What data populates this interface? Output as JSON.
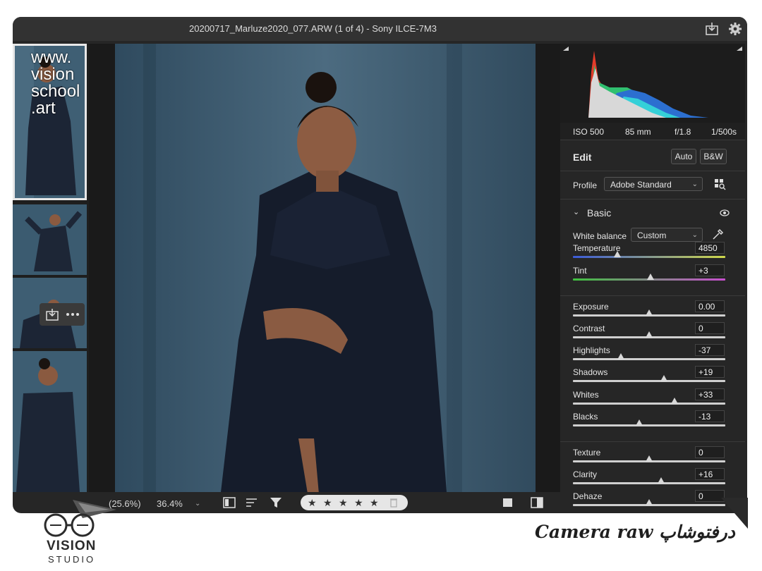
{
  "window": {
    "title": "20200717_Marluze2020_077.ARW (1 of 4)  -  Sony ILCE-7M3",
    "icons": [
      "save-icon",
      "gear-icon"
    ]
  },
  "watermark": {
    "lines": [
      "www.",
      "vision",
      "school",
      ".art"
    ]
  },
  "filmstrip": {
    "thumbnail_count": 4,
    "selected_index": 0,
    "overlay_icons": [
      "import-icon",
      "more-icon"
    ]
  },
  "bottom_bar": {
    "fit_zoom": "(25.6%)",
    "zoom": "36.4%",
    "stars": [
      "★",
      "★",
      "★",
      "★",
      "★"
    ],
    "icons": [
      "filmstrip-toggle-icon",
      "sort-icon",
      "filter-icon",
      "trash-icon",
      "view-mode-icon",
      "before-after-icon"
    ]
  },
  "exif": {
    "iso": "ISO 500",
    "focal": "85 mm",
    "aperture": "f/1.8",
    "shutter": "1/500s"
  },
  "edit": {
    "title": "Edit",
    "auto_label": "Auto",
    "bw_label": "B&W",
    "profile_label": "Profile",
    "profile_value": "Adobe Standard",
    "basic_label": "Basic",
    "wb_label": "White balance",
    "wb_value": "Custom"
  },
  "sliders": [
    {
      "label": "Temperature",
      "value": "4850",
      "pos": 0.29,
      "track": "temperature"
    },
    {
      "label": "Tint",
      "value": "+3",
      "pos": 0.51,
      "track": "tint"
    },
    {
      "label": "Exposure",
      "value": "0.00",
      "pos": 0.5,
      "track": "plain"
    },
    {
      "label": "Contrast",
      "value": "0",
      "pos": 0.5,
      "track": "plain"
    },
    {
      "label": "Highlights",
      "value": "-37",
      "pos": 0.315,
      "track": "plain"
    },
    {
      "label": "Shadows",
      "value": "+19",
      "pos": 0.595,
      "track": "plain"
    },
    {
      "label": "Whites",
      "value": "+33",
      "pos": 0.665,
      "track": "plain"
    },
    {
      "label": "Blacks",
      "value": "-13",
      "pos": 0.435,
      "track": "plain"
    },
    {
      "label": "Texture",
      "value": "0",
      "pos": 0.5,
      "track": "plain"
    },
    {
      "label": "Clarity",
      "value": "+16",
      "pos": 0.58,
      "track": "plain"
    },
    {
      "label": "Dehaze",
      "value": "0",
      "pos": 0.5,
      "track": "plain"
    }
  ],
  "footer": {
    "caption": "Camera raw درفتوشاپ",
    "logo_word": "VISION",
    "logo_sub": "STUDIO"
  }
}
